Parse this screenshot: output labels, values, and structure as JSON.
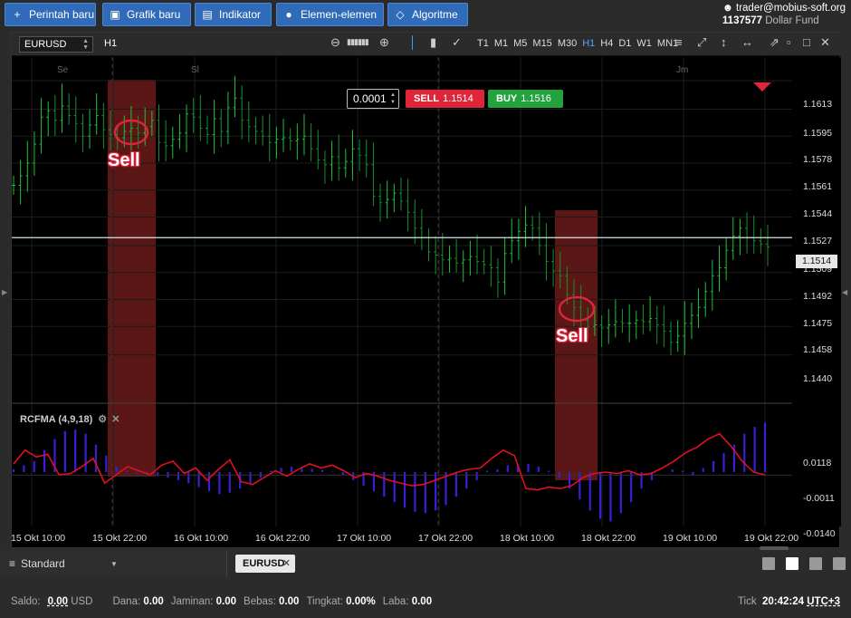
{
  "toolbar": {
    "new_order": "Perintah baru",
    "new_chart": "Grafik baru",
    "indicator": "Indikator",
    "elements": "Elemen-elemen",
    "algorithm": "Algoritme"
  },
  "account": {
    "email": "trader@mobius-soft.org",
    "number": "1137577",
    "fund": "Dollar Fund"
  },
  "chart": {
    "symbol": "EURUSD",
    "timeframe": "H1",
    "timeframes": [
      "T1",
      "M1",
      "M5",
      "M15",
      "M30",
      "H1",
      "H4",
      "D1",
      "W1",
      "MN1"
    ],
    "active_timeframe": "H1",
    "lot": "0.0001",
    "sell_label": "SELL",
    "sell_price": "1.1514",
    "buy_label": "BUY",
    "buy_price": "1.1516",
    "current_price": "1.1514",
    "session_labels": [
      "Se",
      "Sl",
      "Jm"
    ],
    "indicator_label": "RCFMA (4,9,18)",
    "annotation_text": "Sell",
    "colors": {
      "bull": "#22c03a",
      "bear": "#1a8f2a",
      "sell": "#e0243a",
      "buy": "#22a33d",
      "signal": "#e01020",
      "histo": "#3a1fd8",
      "highlight": "#7a1e1e"
    }
  },
  "chart_data": [
    {
      "type": "ohlc",
      "title": "EURUSD H1",
      "ylim": [
        1.1425,
        1.1625
      ],
      "price_ticks": [
        "1.1613",
        "1.1595",
        "1.1578",
        "1.1561",
        "1.1544",
        "1.1527",
        "1.1509",
        "1.1492",
        "1.1475",
        "1.1458",
        "1.1440"
      ],
      "x_labels": [
        "15 Okt 10:00",
        "15 Okt 22:00",
        "16 Okt 10:00",
        "16 Okt 22:00",
        "17 Okt 10:00",
        "17 Okt 22:00",
        "18 Okt 10:00",
        "18 Okt 22:00",
        "19 Okt 10:00",
        "19 Okt 22:00"
      ],
      "close": [
        1.1547,
        1.1553,
        1.1561,
        1.1573,
        1.159,
        1.1594,
        1.1588,
        1.1597,
        1.1591,
        1.1586,
        1.1578,
        1.1585,
        1.1591,
        1.1582,
        1.1579,
        1.1577,
        1.1581,
        1.1583,
        1.158,
        1.1584,
        1.1588,
        1.1574,
        1.1572,
        1.1576,
        1.158,
        1.1592,
        1.159,
        1.1583,
        1.1579,
        1.1589,
        1.1581,
        1.1596,
        1.1602,
        1.1588,
        1.1584,
        1.1581,
        1.1578,
        1.1574,
        1.1576,
        1.1577,
        1.1575,
        1.1576,
        1.1578,
        1.157,
        1.1563,
        1.156,
        1.1565,
        1.1558,
        1.1562,
        1.157,
        1.1566,
        1.156,
        1.154,
        1.1536,
        1.1538,
        1.1542,
        1.1537,
        1.153,
        1.152,
        1.1514,
        1.1505,
        1.1503,
        1.15,
        1.1501,
        1.1498,
        1.15,
        1.1502,
        1.1499,
        1.1497,
        1.1495,
        1.1486,
        1.1504,
        1.1512,
        1.1518,
        1.1522,
        1.152,
        1.1509,
        1.1499,
        1.1493,
        1.149,
        1.1478,
        1.147,
        1.1462,
        1.1458,
        1.1459,
        1.1457,
        1.1459,
        1.1461,
        1.146,
        1.146,
        1.1462,
        1.1461,
        1.1463,
        1.1459,
        1.1455,
        1.1448,
        1.1452,
        1.146,
        1.1465,
        1.147,
        1.148,
        1.149,
        1.1495,
        1.1506,
        1.1515,
        1.152,
        1.1514,
        1.1512,
        1.151,
        1.1508
      ],
      "current": 1.1514
    },
    {
      "type": "histogram+line",
      "title": "RCFMA (4,9,18)",
      "ylim": [
        -0.0195,
        0.0175
      ],
      "ticks": [
        "0.0118",
        "-0.0011",
        "-0.0140"
      ],
      "histogram": [
        0.001,
        0.0025,
        0.004,
        0.008,
        0.012,
        0.015,
        0.0155,
        0.014,
        0.01,
        0.006,
        0.002,
        0.0005,
        -0.0005,
        -0.001,
        -0.0015,
        -0.002,
        -0.003,
        -0.004,
        -0.0055,
        -0.007,
        -0.008,
        -0.0075,
        -0.006,
        -0.004,
        -0.002,
        0.0005,
        0.0015,
        0.002,
        0.0018,
        0.0012,
        0.0008,
        0.0002,
        -0.001,
        -0.003,
        -0.005,
        -0.007,
        -0.009,
        -0.011,
        -0.013,
        -0.0145,
        -0.015,
        -0.014,
        -0.012,
        -0.009,
        -0.006,
        -0.003,
        0.0005,
        0.001,
        0.0025,
        0.003,
        0.003,
        0.002,
        0.0005,
        -0.002,
        -0.006,
        -0.01,
        -0.014,
        -0.017,
        -0.018,
        -0.015,
        -0.011,
        -0.006,
        -0.003,
        0.0,
        0.001,
        0.0005,
        -0.001,
        0.0015,
        0.004,
        0.007,
        0.01,
        0.014,
        0.0165,
        0.018
      ],
      "signal": [
        0.003,
        0.008,
        0.0055,
        0.0065,
        -0.001,
        -0.0005,
        0.002,
        0.005,
        -0.004,
        -0.001,
        0.002,
        0.0005,
        -0.001,
        0.0025,
        0.004,
        -0.0005,
        0.0015,
        -0.003,
        0.001,
        0.0045,
        -0.0035,
        -0.0045,
        -0.002,
        0.0005,
        -0.0015,
        0.001,
        0.003,
        0.0015,
        0.0025,
        0.0005,
        -0.002,
        -0.0005,
        -0.0015,
        -0.003,
        -0.004,
        -0.005,
        -0.0045,
        -0.003,
        -0.0015,
        0.0,
        0.001,
        0.0015,
        0.005,
        0.008,
        0.006,
        -0.006,
        -0.0065,
        -0.0055,
        -0.006,
        -0.005,
        -0.002,
        -0.0005,
        0.0,
        -0.0005,
        0.0005,
        -0.001,
        -0.0005,
        0.0015,
        0.004,
        0.007,
        0.009,
        0.012,
        0.014,
        0.0095,
        0.004,
        0.0,
        -0.001
      ]
    }
  ],
  "bottom": {
    "workspace": "Standard",
    "tab": "EURUSD"
  },
  "status": {
    "saldo_label": "Saldo:",
    "saldo_value": "0.00",
    "saldo_unit": "USD",
    "dana_label": "Dana:",
    "dana_value": "0.00",
    "jaminan_label": "Jaminan:",
    "jaminan_value": "0.00",
    "bebas_label": "Bebas:",
    "bebas_value": "0.00",
    "tingkat_label": "Tingkat:",
    "tingkat_value": "0.00%",
    "laba_label": "Laba:",
    "laba_value": "0.00",
    "tick_label": "Tick",
    "time": "20:42:24",
    "tz": "UTC+3"
  }
}
